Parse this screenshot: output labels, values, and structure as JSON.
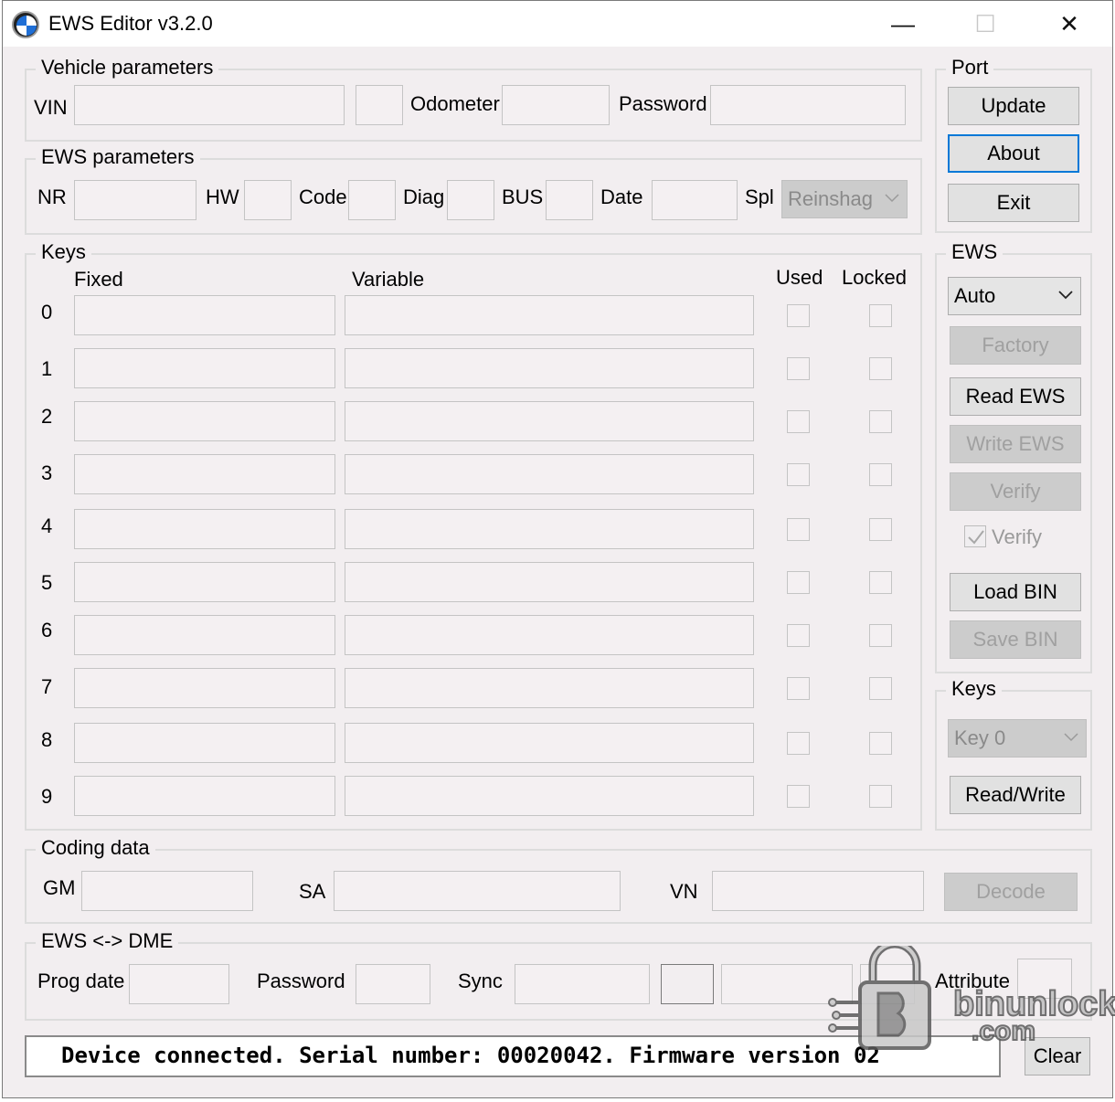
{
  "window": {
    "title": "EWS Editor v3.2.0",
    "minimize": "—",
    "maximize": "☐",
    "close": "✕"
  },
  "vehicle": {
    "title": "Vehicle parameters",
    "vin_label": "VIN",
    "odometer_label": "Odometer",
    "password_label": "Password"
  },
  "ews_params": {
    "title": "EWS parameters",
    "nr": "NR",
    "hw": "HW",
    "code": "Code",
    "diag": "Diag",
    "bus": "BUS",
    "date": "Date",
    "spl": "Spl",
    "spl_value": "Reinshag"
  },
  "keys": {
    "title": "Keys",
    "fixed": "Fixed",
    "variable": "Variable",
    "used": "Used",
    "locked": "Locked",
    "rows": [
      "0",
      "1",
      "2",
      "3",
      "4",
      "5",
      "6",
      "7",
      "8",
      "9"
    ]
  },
  "port": {
    "title": "Port",
    "update": "Update",
    "about": "About",
    "exit": "Exit"
  },
  "ews": {
    "title": "EWS",
    "mode": "Auto",
    "factory": "Factory",
    "read": "Read EWS",
    "write": "Write EWS",
    "verify_btn": "Verify",
    "verify_chk": "Verify",
    "load": "Load BIN",
    "save": "Save BIN"
  },
  "keys_panel": {
    "title": "Keys",
    "selected": "Key 0",
    "readwrite": "Read/Write"
  },
  "coding": {
    "title": "Coding data",
    "gm": "GM",
    "sa": "SA",
    "vn": "VN",
    "decode": "Decode"
  },
  "dme": {
    "title": "EWS <-> DME",
    "prog_date": "Prog date",
    "password": "Password",
    "sync": "Sync",
    "attribute": "Attribute"
  },
  "status": {
    "text": "Device connected. Serial number: 00020042. Firmware version 02",
    "clear": "Clear"
  },
  "watermark": {
    "line1": "binunlock",
    "line2": ".com"
  }
}
